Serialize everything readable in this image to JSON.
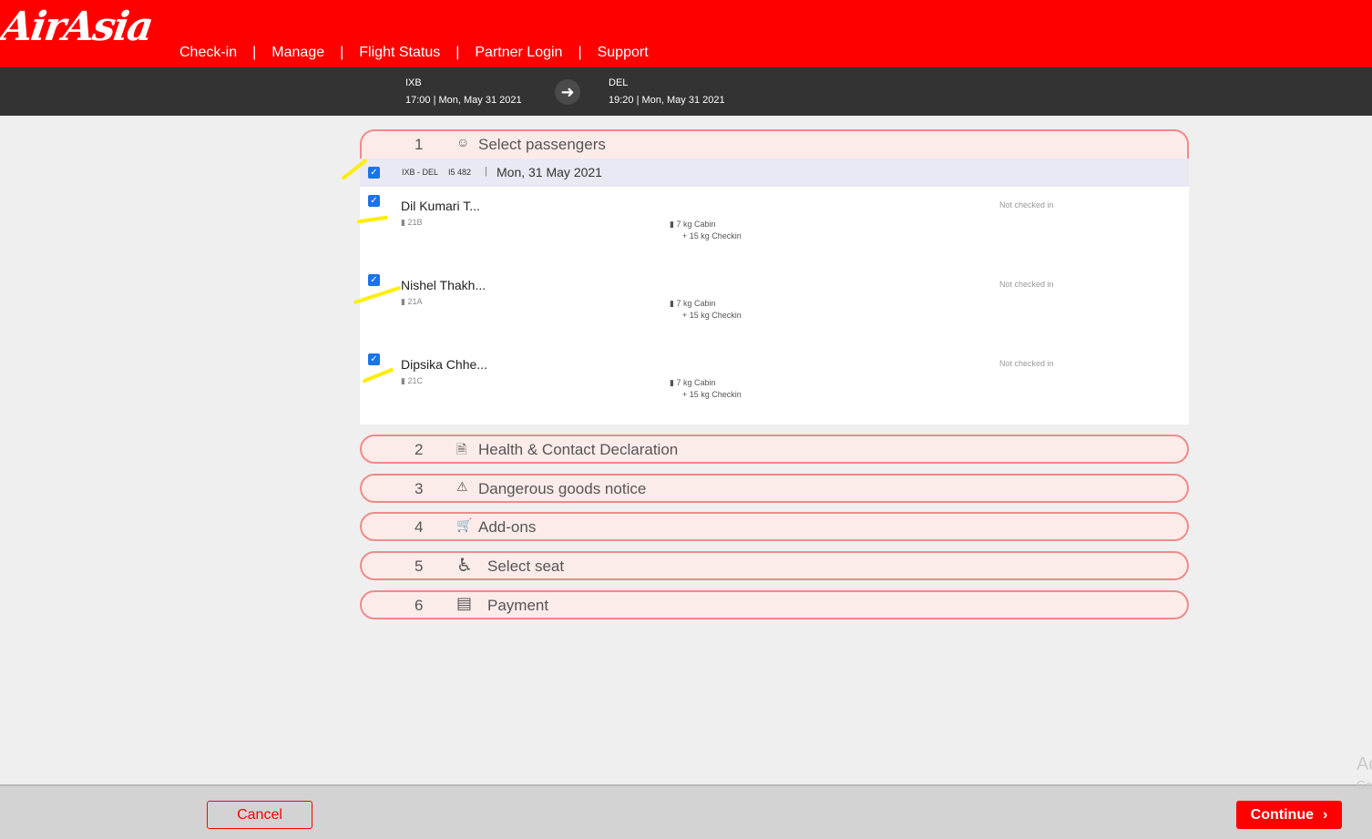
{
  "header": {
    "logo_text": "AirAsia",
    "nav": [
      "Check-in",
      "Manage",
      "Flight Status",
      "Partner Login",
      "Support"
    ],
    "separator": "|"
  },
  "flight": {
    "origin_code": "IXB",
    "origin_time": "17:00 | Mon, May 31 2021",
    "dest_code": "DEL",
    "dest_time": "19:20 | Mon, May 31 2021",
    "arrow_icon": "arrow-right-icon"
  },
  "steps": [
    {
      "num": "1",
      "label": "Select passengers",
      "icon": "person-icon"
    },
    {
      "num": "2",
      "label": "Health & Contact Declaration",
      "icon": "document-icon"
    },
    {
      "num": "3",
      "label": "Dangerous goods notice",
      "icon": "warning-icon"
    },
    {
      "num": "4",
      "label": "Add-ons",
      "icon": "cart-icon"
    },
    {
      "num": "5",
      "label": "Select seat",
      "icon": "seat-icon"
    },
    {
      "num": "6",
      "label": "Payment",
      "icon": "card-icon"
    }
  ],
  "flight_row": {
    "route": "IXB - DEL",
    "flight_number": "I5 482",
    "sep": "|",
    "date": "Mon, 31 May 2021",
    "checked": true
  },
  "passengers": [
    {
      "name": "Dil Kumari T...",
      "seat": "21B",
      "cabin": "7 kg Cabin",
      "checkin": "+ 15 kg Checkin",
      "status": "Not checked in",
      "checked": true
    },
    {
      "name": "Nishel Thakh...",
      "seat": "21A",
      "cabin": "7 kg Cabin",
      "checkin": "+ 15 kg Checkin",
      "status": "Not checked in",
      "checked": true
    },
    {
      "name": "Dipsika Chhe...",
      "seat": "21C",
      "cabin": "7 kg Cabin",
      "checkin": "+ 15 kg Checkin",
      "status": "Not checked in",
      "checked": true
    }
  ],
  "footer": {
    "cancel_label": "Cancel",
    "continue_label": "Continue",
    "watermark_line1": "Ac",
    "watermark_line2": "Ge"
  },
  "colors": {
    "brand_red": "#ff0000",
    "flightbar": "#333333",
    "step_border": "#f08a8a",
    "step_bg": "#fbecea",
    "checkbox": "#1a73e8",
    "highlight": "#ffee00"
  }
}
